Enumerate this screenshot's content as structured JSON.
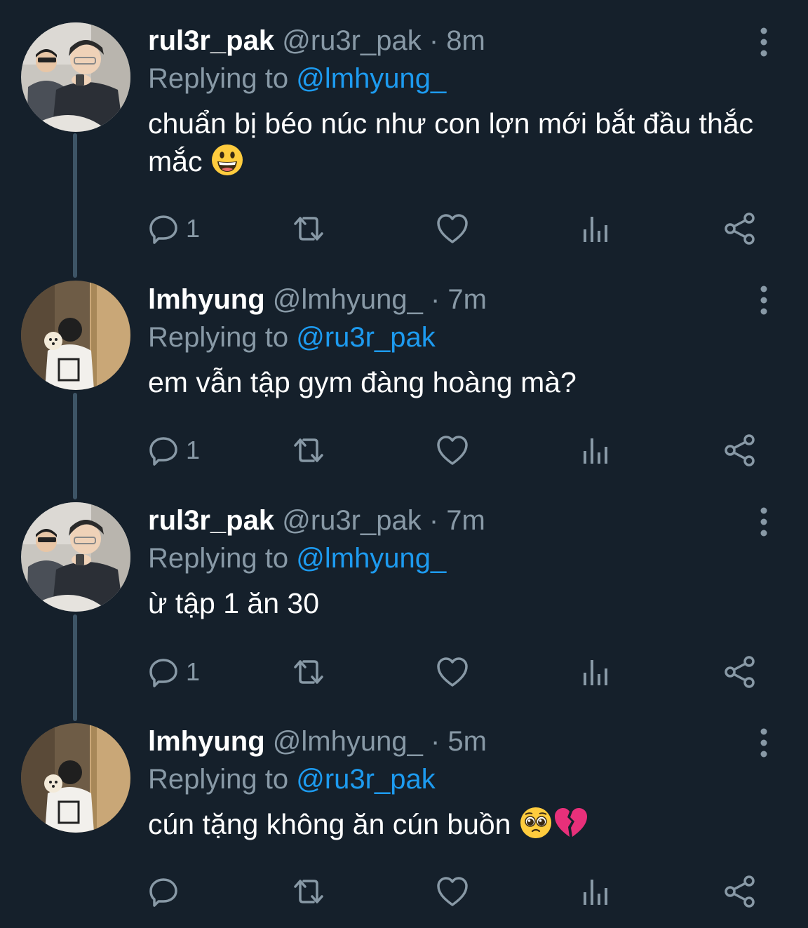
{
  "colors": {
    "background": "#15202b",
    "text": "#ffffff",
    "muted": "#8899a6",
    "link": "#1d9bf0",
    "thread_line": "#3d5466"
  },
  "reply_prefix": "Replying to",
  "tweets": [
    {
      "display_name": "rul3r_pak",
      "handle": "@ru3r_pak",
      "dot": "·",
      "time": "8m",
      "reply_to": "@lmhyung_",
      "text": "chuẩn bị béo núc như con lợn mới bắt đầu thắc mắc",
      "emoji": "grinning-face",
      "reply_count": "1",
      "avatar": "ruler-pak-photo"
    },
    {
      "display_name": "lmhyung",
      "handle": "@lmhyung_",
      "dot": "·",
      "time": "7m",
      "reply_to": "@ru3r_pak",
      "text": "em vẫn tập gym đàng hoàng mà?",
      "reply_count": "1",
      "avatar": "lmhyung-photo"
    },
    {
      "display_name": "rul3r_pak",
      "handle": "@ru3r_pak",
      "dot": "·",
      "time": "7m",
      "reply_to": "@lmhyung_",
      "text": "ừ tập 1 ăn 30",
      "reply_count": "1",
      "avatar": "ruler-pak-photo"
    },
    {
      "display_name": "lmhyung",
      "handle": "@lmhyung_",
      "dot": "·",
      "time": "5m",
      "reply_to": "@ru3r_pak",
      "text": "cún tặng không ăn cún buồn",
      "emoji": "pleading-face, broken-heart",
      "reply_count": "",
      "avatar": "lmhyung-photo"
    }
  ],
  "icons": {
    "reply": "reply-icon",
    "retweet": "retweet-icon",
    "like": "like-icon",
    "analytics": "analytics-icon",
    "share": "share-icon",
    "more": "more-vertical-icon"
  }
}
